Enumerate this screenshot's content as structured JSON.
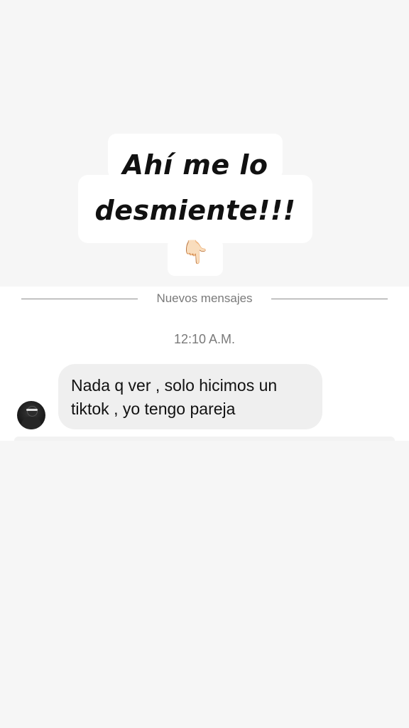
{
  "story_overlay": {
    "line_1": "Ahí me lo",
    "line_2": "desmiente!!!",
    "emoji": "👇🏻",
    "emoji_icon": "pointing-down-hand-icon"
  },
  "chat": {
    "divider_label": "Nuevos mensajes",
    "timestamp": "12:10 A.M.",
    "messages": [
      {
        "sender": "incoming",
        "text": "Nada q ver , solo hicimos un tiktok , yo tengo pareja"
      }
    ]
  },
  "colors": {
    "background": "#f6f6f6",
    "chat_panel": "#ffffff",
    "bubble": "#efefef",
    "meta_text": "#7a7a7a"
  }
}
